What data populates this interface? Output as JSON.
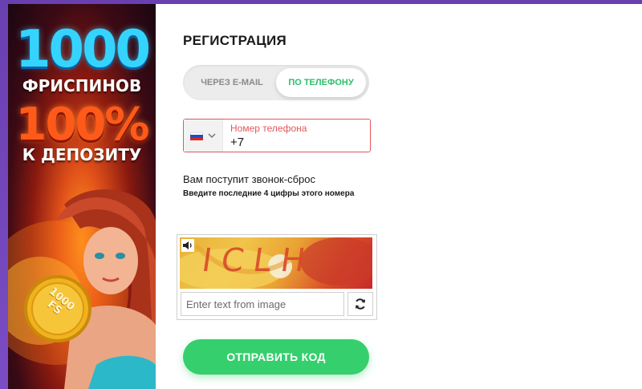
{
  "promo": {
    "line1": "1000",
    "line2": "ФРИСПИНОВ",
    "line3": "100%",
    "line4": "К ДЕПОЗИТУ",
    "coin_text": "1000 FS"
  },
  "form": {
    "title": "РЕГИСТРАЦИЯ",
    "tabs": [
      {
        "label": "ЧЕРЕЗ E-MAIL",
        "active": false
      },
      {
        "label": "ПО ТЕЛЕФОНУ",
        "active": true
      }
    ],
    "phone": {
      "country_flag": "russia-flag-icon",
      "label": "Номер телефона",
      "value": "+7"
    },
    "info_line1": "Вам поступит звонок-сброс",
    "info_line2": "Введите последние 4 цифры этого номера",
    "captcha": {
      "image_text": "ICLH",
      "placeholder": "Enter text from image"
    },
    "submit_label": "ОТПРАВИТЬ КОД"
  },
  "colors": {
    "accent_green": "#35cf6e",
    "error_red": "#e2575a",
    "background_purple": "#6a3fb0"
  }
}
